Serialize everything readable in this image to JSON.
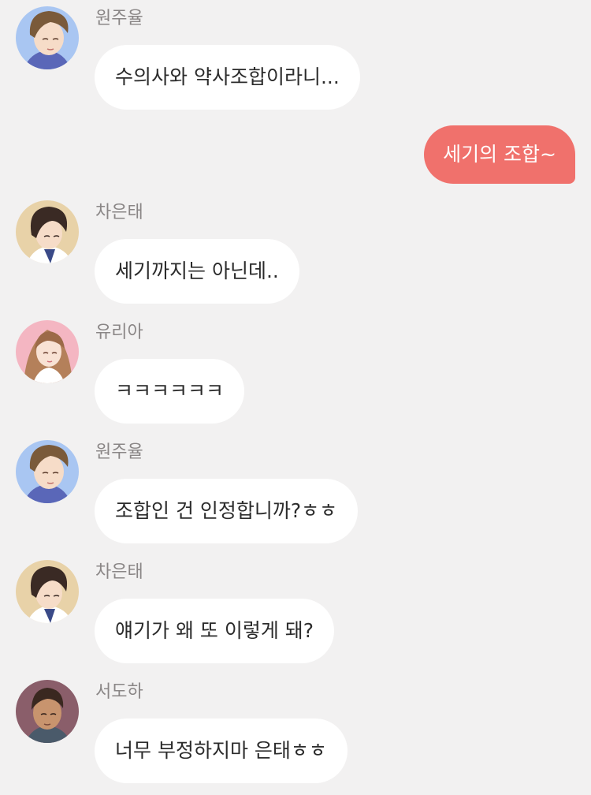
{
  "messages": [
    {
      "sender": "원주율",
      "text": "수의사와 약사조합이라니..."
    },
    {
      "text": "세기의 조합~"
    },
    {
      "sender": "차은태",
      "text": "세기까지는 아닌데.."
    },
    {
      "sender": "유리아",
      "text": "ㅋㅋㅋㅋㅋㅋ"
    },
    {
      "sender": "원주율",
      "text": "조합인 건 인정합니까?ㅎㅎ"
    },
    {
      "sender": "차은태",
      "text": "얘기가 왜 또 이렇게 돼?"
    },
    {
      "sender": "서도하",
      "text": "너무 부정하지마 은태ㅎㅎ"
    }
  ],
  "colors": {
    "background": "#f2f1f1",
    "incoming_bubble": "#ffffff",
    "outgoing_bubble": "#f0716c",
    "sender_name": "#8a8686"
  }
}
